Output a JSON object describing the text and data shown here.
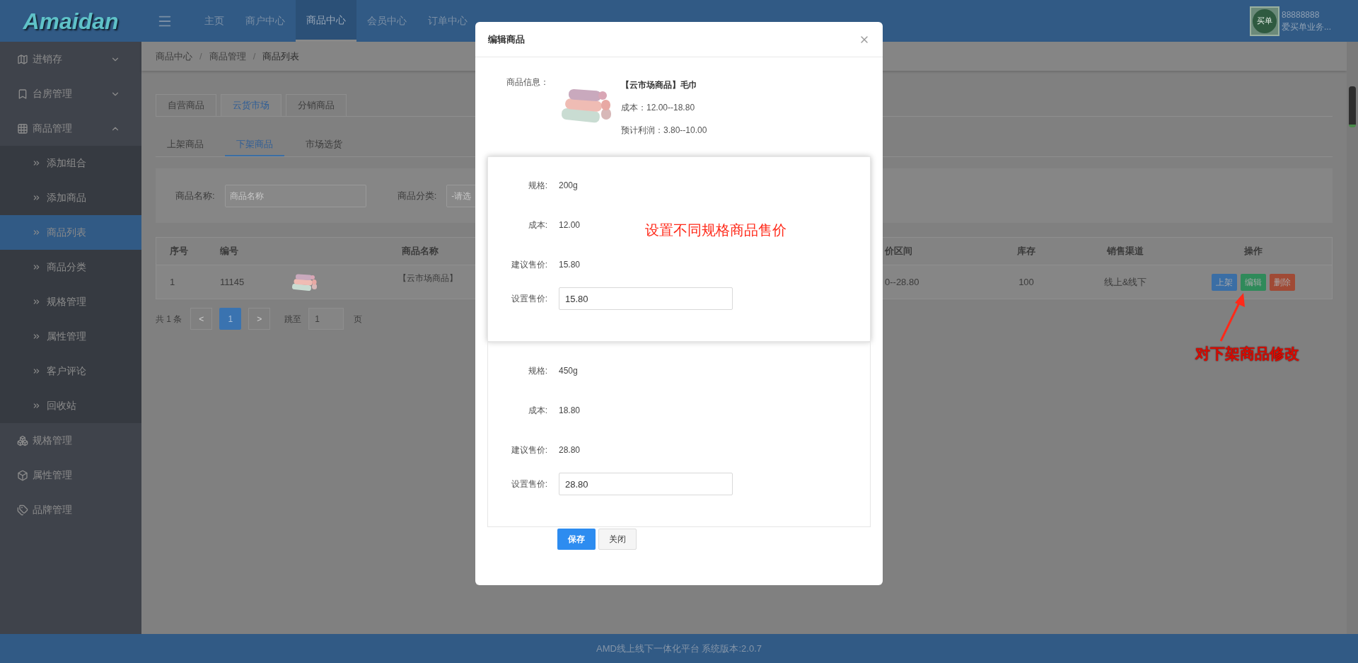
{
  "logo": "Amaidan",
  "top_nav": [
    {
      "label": "主页",
      "selected": false
    },
    {
      "label": "商户中心",
      "selected": false
    },
    {
      "label": "商品中心",
      "selected": true
    },
    {
      "label": "会员中心",
      "selected": false
    },
    {
      "label": "订单中心",
      "selected": false
    }
  ],
  "user": {
    "badge": "买单",
    "account": "88888888",
    "shop": "爱买单业务..."
  },
  "sidebar": [
    {
      "kind": "group",
      "label": "进销存",
      "expanded": false
    },
    {
      "kind": "group",
      "label": "台房管理",
      "expanded": false
    },
    {
      "kind": "group",
      "label": "商品管理",
      "expanded": true,
      "children": [
        {
          "label": "添加组合",
          "selected": false
        },
        {
          "label": "添加商品",
          "selected": false
        },
        {
          "label": "商品列表",
          "selected": true
        },
        {
          "label": "商品分类",
          "selected": false
        },
        {
          "label": "规格管理",
          "selected": false
        },
        {
          "label": "属性管理",
          "selected": false
        },
        {
          "label": "客户评论",
          "selected": false
        },
        {
          "label": "回收站",
          "selected": false
        }
      ]
    },
    {
      "kind": "link",
      "label": "规格管理"
    },
    {
      "kind": "link",
      "label": "属性管理"
    },
    {
      "kind": "link",
      "label": "品牌管理"
    }
  ],
  "breadcrumb": [
    "商品中心",
    "商品管理",
    "商品列表"
  ],
  "breadcrumb_separators": [
    "/",
    "/"
  ],
  "source_tabs": [
    {
      "label": "自营商品",
      "selected": false
    },
    {
      "label": "云货市场",
      "selected": true
    },
    {
      "label": "分销商品",
      "selected": false
    }
  ],
  "status_tabs": [
    {
      "label": "上架商品",
      "selected": false
    },
    {
      "label": "下架商品",
      "selected": true
    },
    {
      "label": "市场选货",
      "selected": false
    }
  ],
  "filters": [
    {
      "label": "商品名称:",
      "placeholder": "商品名称"
    },
    {
      "label": "商品分类:",
      "placeholder": "-请选"
    }
  ],
  "table": {
    "columns": [
      "序号",
      "编号",
      "商品名称",
      "价区间",
      "库存",
      "销售渠道",
      "操作"
    ],
    "rows": [
      {
        "index": "1",
        "code": "11145",
        "name": "【云市场商品】",
        "price_range": "0--28.80",
        "stock": "100",
        "channel": "线上&线下",
        "actions": [
          {
            "label": "上架",
            "kind": "primary"
          },
          {
            "label": "编辑",
            "kind": "success"
          },
          {
            "label": "删除",
            "kind": "danger"
          }
        ]
      }
    ]
  },
  "pagination": {
    "total": "共 1 条",
    "prev": "<",
    "pages": [
      {
        "label": "1",
        "selected": true
      }
    ],
    "next": ">",
    "jump_label": "跳至",
    "jump_value": "1",
    "unit": "页"
  },
  "modal": {
    "title": "编辑商品",
    "product": {
      "label": "商品信息：",
      "name": "【云市场商品】毛巾",
      "cost": "成本：12.00--18.80",
      "profit": "预计利润：3.80--10.00"
    },
    "specs": [
      {
        "highlighted": true,
        "rows": [
          {
            "label": "规格:",
            "value": "200g"
          },
          {
            "label": "成本:",
            "value": "12.00"
          },
          {
            "label": "建议售价:",
            "value": "15.80"
          }
        ],
        "price_label": "设置售价:",
        "price": "15.80"
      },
      {
        "highlighted": false,
        "rows": [
          {
            "label": "规格:",
            "value": "450g"
          },
          {
            "label": "成本:",
            "value": "18.80"
          },
          {
            "label": "建议售价:",
            "value": "28.80"
          }
        ],
        "price_label": "设置售价:",
        "price": "28.80"
      }
    ],
    "buttons": [
      {
        "label": "保存",
        "kind": "primary"
      },
      {
        "label": "关闭",
        "kind": "default"
      }
    ]
  },
  "annotations": {
    "spec_note": "设置不同规格商品售价",
    "edit_note": "对下架商品修改"
  },
  "footer": "AMD线上线下一体化平台 系统版本:2.0.7"
}
